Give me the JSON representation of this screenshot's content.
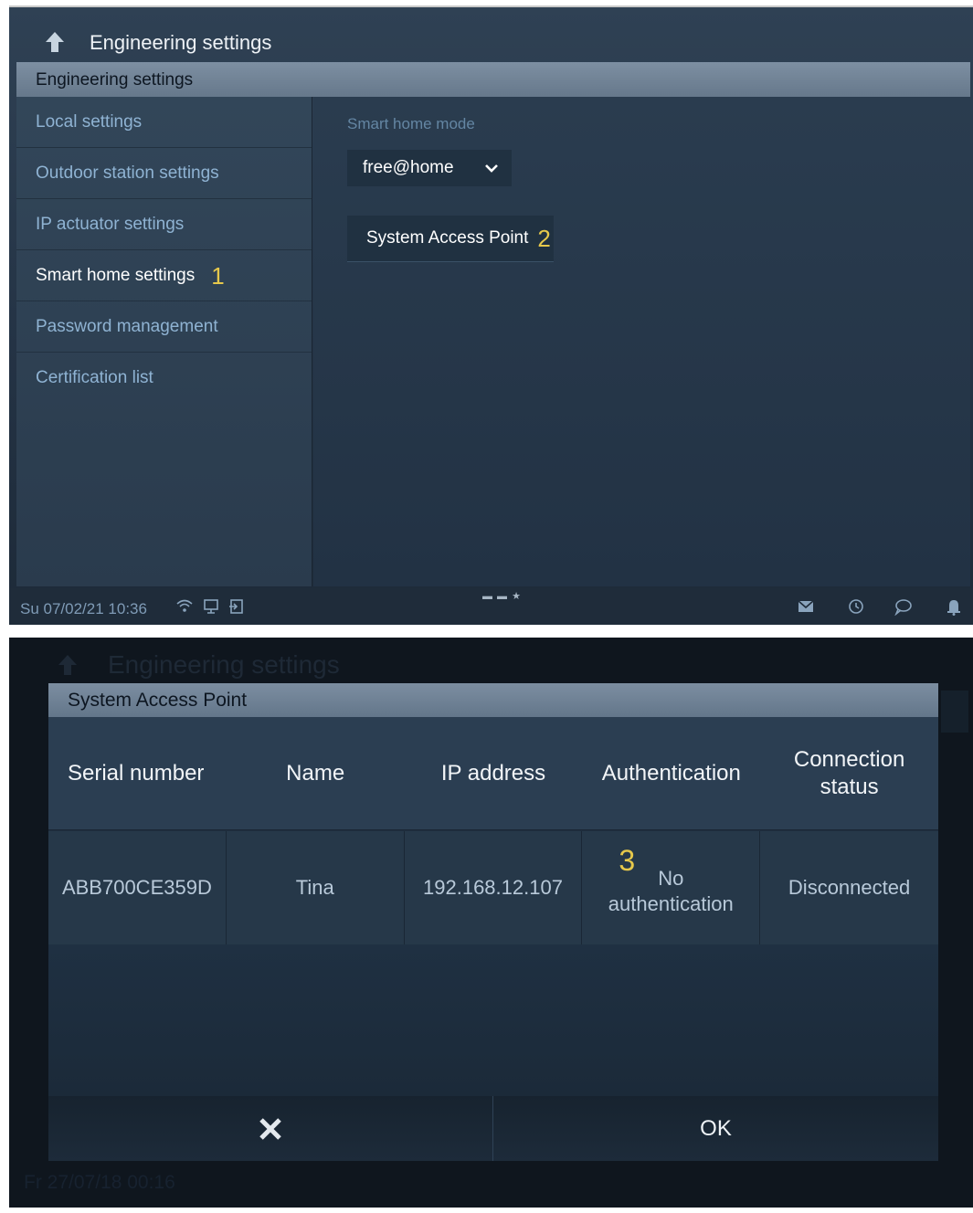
{
  "screen1": {
    "window_title": "Engineering settings",
    "subheader": "Engineering settings",
    "sidebar": {
      "items": [
        {
          "label": "Local settings"
        },
        {
          "label": "Outdoor station settings"
        },
        {
          "label": "IP actuator settings"
        },
        {
          "label": "Smart home settings",
          "marker": "1"
        },
        {
          "label": "Password management"
        },
        {
          "label": "Certification list"
        }
      ]
    },
    "main": {
      "mode_label": "Smart home mode",
      "mode_value": "free@home",
      "sap_button": "System Access Point",
      "sap_marker": "2"
    },
    "statusbar": {
      "date_time": "Su 07/02/21   10:36",
      "pager": "▬ ▬ ★"
    }
  },
  "screen2": {
    "background_title": "Engineering settings",
    "background_status": "Fr 27/07/18   00:16",
    "dialog": {
      "title": "System Access Point",
      "columns": [
        "Serial number",
        "Name",
        "IP address",
        "Authentication",
        "Connection\nstatus"
      ],
      "row": {
        "serial": "ABB700CE359D",
        "name": "Tina",
        "ip": "192.168.12.107",
        "auth_marker": "3",
        "auth": "No\nauthentication",
        "status": "Disconnected"
      },
      "ok_label": "OK"
    }
  },
  "colors": {
    "accent_marker": "#e6c84b",
    "inactive_text": "#8fb3d3",
    "header_bar": "#6f8295"
  },
  "icons": [
    "back-arrow-icon",
    "chevron-down-icon",
    "wifi-icon",
    "monitor-icon",
    "logout-icon",
    "mail-icon",
    "history-icon",
    "chat-icon",
    "bell-icon",
    "close-icon"
  ]
}
